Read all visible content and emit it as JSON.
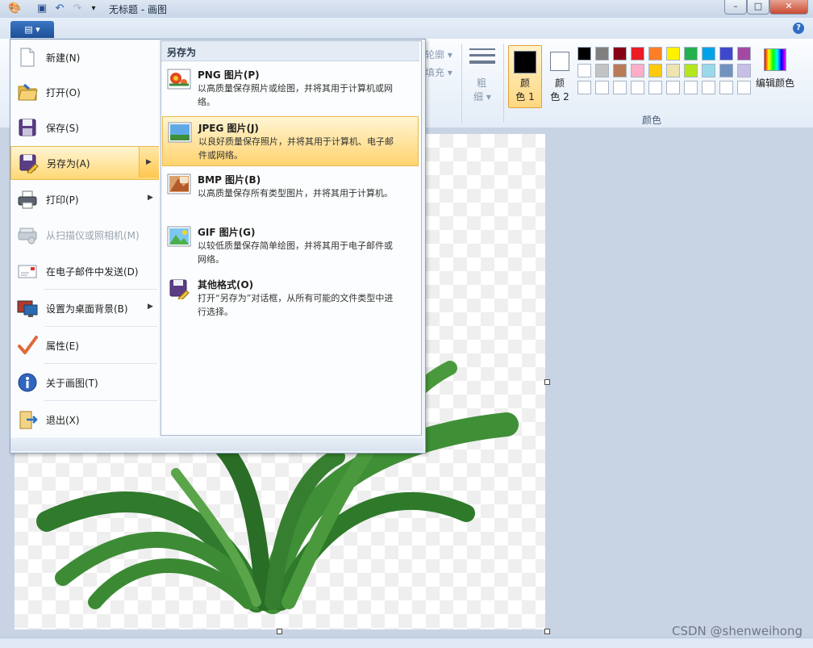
{
  "window": {
    "title": "无标题 - 画图",
    "minimize_glyph": "–",
    "maximize_glyph": "□",
    "close_glyph": "✕"
  },
  "ribbon": {
    "outline_label": "轮廓",
    "fill_label": "填充",
    "size_label_line1": "粗",
    "size_label_line2": "细",
    "color1_line1": "颜",
    "color1_line2": "色 1",
    "color2_line1": "颜",
    "color2_line2": "色 2",
    "colors_group_label": "颜色",
    "edit_colors_label": "编辑颜色",
    "help_glyph": "?",
    "color1_value": "#000000",
    "color2_value": "#ffffff",
    "palette_row1": [
      "#000000",
      "#7f7f7f",
      "#880015",
      "#ed1c24",
      "#ff7f27",
      "#fff200",
      "#22b14c",
      "#00a2e8",
      "#3f48cc",
      "#a349a4"
    ],
    "palette_row2": [
      "#ffffff",
      "#c3c3c3",
      "#b97a57",
      "#ffaec9",
      "#ffc90e",
      "#efe4b0",
      "#b5e61d",
      "#99d9ea",
      "#7092be",
      "#c8bfe7"
    ],
    "palette_row3": [
      "#ffffff",
      "#ffffff",
      "#ffffff",
      "#ffffff",
      "#ffffff",
      "#ffffff",
      "#ffffff",
      "#ffffff",
      "#ffffff",
      "#ffffff"
    ]
  },
  "app_menu": {
    "button_glyph": "▤ ▾",
    "items": [
      {
        "label": "新建(N)",
        "icon": "new-file-icon"
      },
      {
        "label": "打开(O)",
        "icon": "open-folder-icon"
      },
      {
        "label": "保存(S)",
        "icon": "save-disk-icon"
      },
      {
        "label": "另存为(A)",
        "icon": "save-as-icon"
      },
      {
        "label": "打印(P)",
        "icon": "printer-icon"
      },
      {
        "label": "从扫描仪或照相机(M)",
        "icon": "scanner-icon"
      },
      {
        "label": "在电子邮件中发送(D)",
        "icon": "email-icon"
      },
      {
        "label": "设置为桌面背景(B)",
        "icon": "desktop-background-icon"
      },
      {
        "label": "属性(E)",
        "icon": "checkmark-icon"
      },
      {
        "label": "关于画图(T)",
        "icon": "info-icon"
      },
      {
        "label": "退出(X)",
        "icon": "exit-icon"
      }
    ],
    "arrow_glyph": "▶"
  },
  "save_as_submenu": {
    "header": "另存为",
    "options": [
      {
        "title": "PNG 图片(P)",
        "desc": "以高质量保存照片或绘图，并将其用于计算机或网络。",
        "icon": "png-image-icon"
      },
      {
        "title": "JPEG 图片(J)",
        "desc": "以良好质量保存照片，并将其用于计算机、电子邮件或网络。",
        "icon": "jpeg-image-icon"
      },
      {
        "title": "BMP 图片(B)",
        "desc": "以高质量保存所有类型图片，并将其用于计算机。",
        "icon": "bmp-image-icon"
      },
      {
        "title": "GIF 图片(G)",
        "desc": "以较低质量保存简单绘图，并将其用于电子邮件或网络。",
        "icon": "gif-image-icon"
      },
      {
        "title": "其他格式(O)",
        "desc": "打开“另存为”对话框，从所有可能的文件类型中进行选择。",
        "icon": "other-formats-icon"
      }
    ]
  },
  "watermark": "CSDN @shenweihong"
}
